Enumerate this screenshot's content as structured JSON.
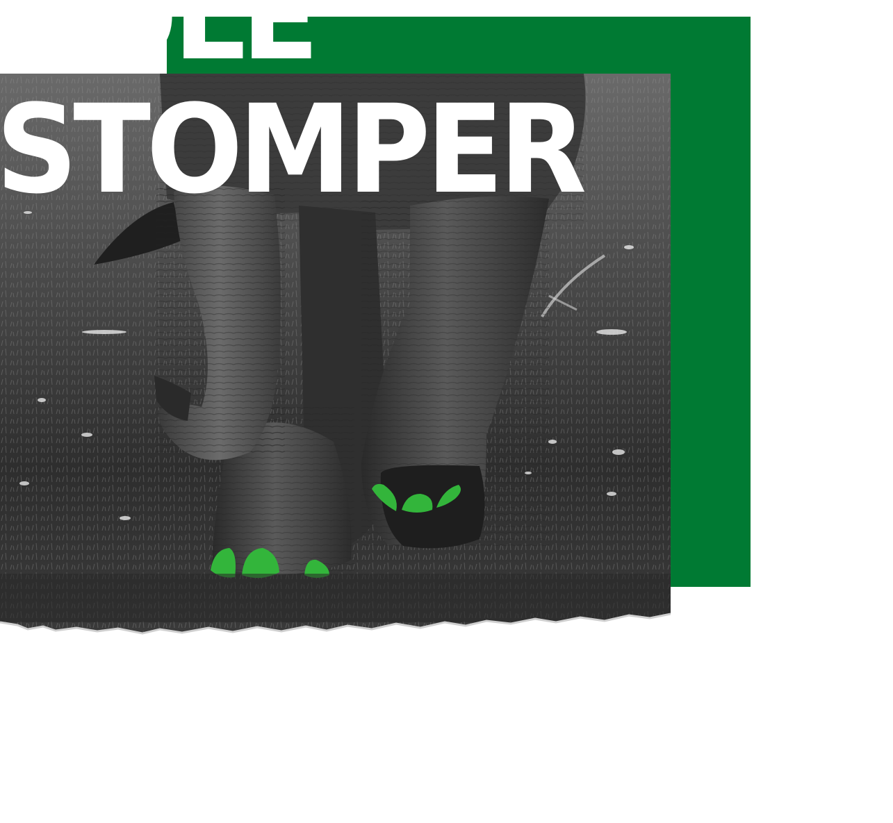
{
  "headline": {
    "line1": "ROLE",
    "line2": "STOMPER"
  },
  "colors": {
    "accent_green": "#007a33",
    "toe_green": "#33b53b",
    "headline_text": "#ffffff",
    "photo_tone": "grayscale"
  },
  "image": {
    "subject": "elephant-feet-walking-on-grass",
    "edge": "torn-paper-bottom"
  }
}
